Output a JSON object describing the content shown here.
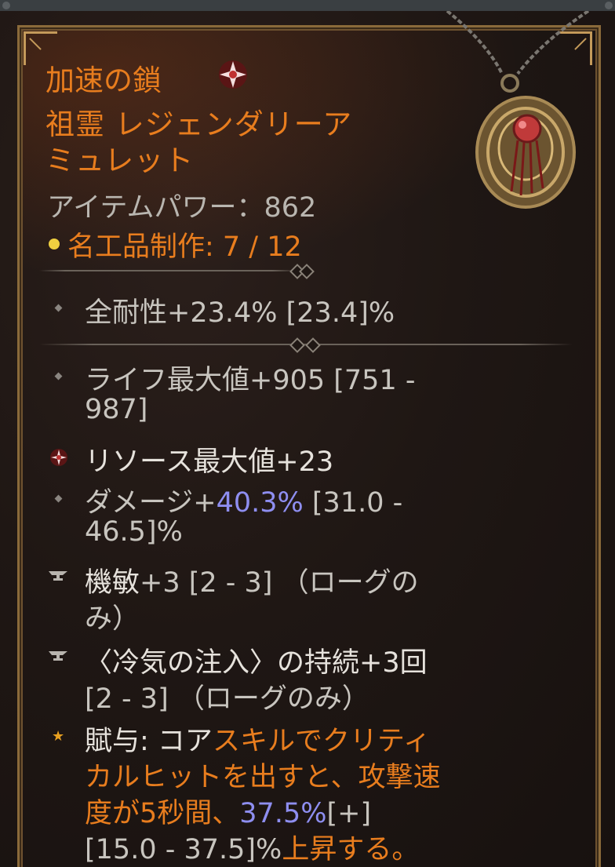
{
  "item": {
    "name": "加速の鎖",
    "name_icon": "resource-gem-icon",
    "type_line1": "祖霊 レジェンダリーア",
    "type_line2": "ミュレット",
    "power": "アイテムパワー：862",
    "masterwork": "名工品制作: 7 / 12",
    "image": "amulet-icon"
  },
  "implicit": {
    "text": "全耐性+23.4% [23.4]%"
  },
  "affixes": [
    {
      "line1": "ライフ最大値+905 [751 -",
      "line2": "987]",
      "bullet": "diamond-bullet-icon"
    },
    {
      "line1": "リソース最大値+23",
      "bullet": "resource-gem-icon"
    },
    {
      "line1_pre": "ダメージ+",
      "line1_value": "40.3%",
      "line1_post": " [31.0 -",
      "line2": "46.5]%",
      "bullet": "diamond-bullet-icon"
    },
    {
      "line1_pre": "機敏",
      "line1_post": "+3 [2 - 3] （ローグの",
      "line2": "み）",
      "bullet": "anvil-icon"
    },
    {
      "line1": "〈冷気の注入〉の持続+3回",
      "line2": "[2 - 3] （ローグのみ）",
      "bullet": "anvil-icon"
    }
  ],
  "aspect": {
    "bullet": "star-icon",
    "l1_label": "賦与: ",
    "l1_white": "コア",
    "l1_orange": "スキルでクリティ",
    "l2": "カルヒットを出すと、攻撃速",
    "l3_pre": "度が5秒間、",
    "l3_value": "37.5%",
    "l3_post": "[+]",
    "l4_range": "[15.0 - 37.5]%",
    "l4_tail": "上昇する。"
  },
  "colors": {
    "title": "#e87d1e",
    "value_blue": "#8e8ef0",
    "text": "#c8c5bf",
    "masterwork_dot": "#f0d040"
  }
}
